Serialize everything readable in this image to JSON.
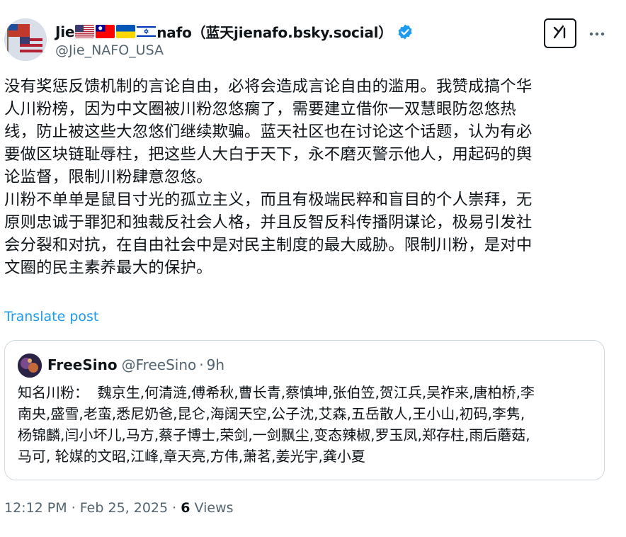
{
  "author": {
    "name_prefix": "Jie",
    "name_suffix": "nafo（蓝天jienafo.bsky.social）",
    "handle": "@Jie_NAFO_USA",
    "flags": [
      "us-flag-icon",
      "taiwan-flag-icon",
      "ukraine-flag-icon",
      "israel-flag-icon"
    ],
    "verified_color": "#1d9bf0"
  },
  "post": {
    "text": "没有奖惩反馈机制的言论自由，必将会造成言论自由的滥用。我赞成搞个华\n人川粉榜，因为中文圈被川粉忽悠瘸了，需要建立借你一双慧眼防忽悠热\n线，防止被这些大忽悠们继续欺骗。蓝天社区也在讨论这个话题，认为有必\n要做区块链耻辱柱，把这些人大白于天下，永不磨灭警示他人，用起码的舆\n论监督，限制川粉肆意忽悠。\n川粉不单单是鼠目寸光的孤立主义，而且有极端民粹和盲目的个人崇拜，无\n原则忠诚于罪犯和独裁反社会人格，并且反智反科传播阴谋论，极易引发社\n会分裂和对抗，在自由社会中是对民主制度的最大威胁。限制川粉，是对中\n文圈的民主素养最大的保护。",
    "translate_label": "Translate post",
    "time": "12:12 PM",
    "date": "Feb 25, 2025",
    "views_count": "6",
    "views_label": "Views",
    "separator": "·"
  },
  "quote": {
    "name": "FreeSino",
    "handle": "@FreeSino",
    "separator": "·",
    "time": "9h",
    "text": "知名川粉：  魏京生,何清涟,傅希秋,曹长青,蔡慎坤,张伯笠,贺江兵,吴祚来,唐柏桥,李\n南央,盛雪,老蛮,悉尼奶爸,昆仑,海阔天空,公子沈,艾森,五岳散人,王小山,初码,李隽,\n杨锦麟,闫小坏儿,马方,蔡子博士,荣剑,一剑飘尘,变态辣椒,罗玉凤,郑存柱,雨后蘑菇,\n马可, 轮媒的文昭,江峰,章天亮,方伟,萧茗,姜光宇,龚小夏"
  },
  "icons": {
    "grok": "grok-icon",
    "more": "more-icon"
  }
}
